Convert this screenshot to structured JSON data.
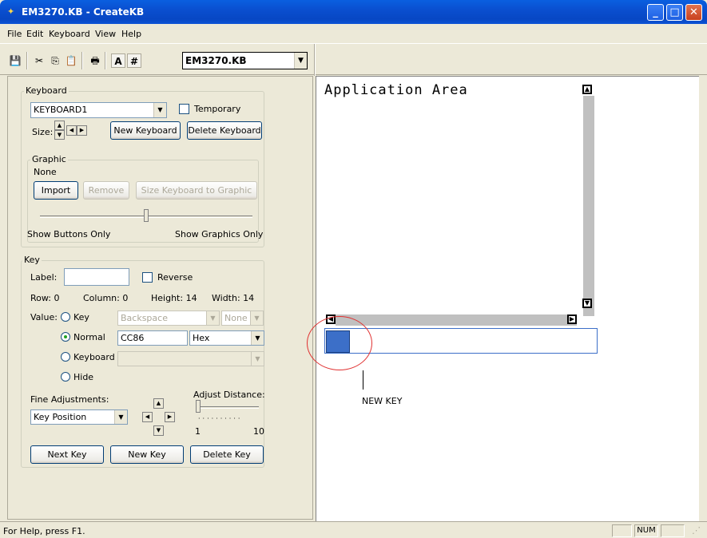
{
  "window": {
    "title": "EM3270.KB - CreateKB"
  },
  "menu": [
    "File",
    "Edit",
    "Keyboard",
    "View",
    "Help"
  ],
  "toolbar": {
    "a_label": "A",
    "hash_label": "#",
    "file_combo": "EM3270.KB"
  },
  "keyboard_group": {
    "legend": "Keyboard",
    "selected_keyboard": "KEYBOARD1",
    "temporary_label": "Temporary",
    "size_label": "Size:",
    "new_keyboard": "New Keyboard",
    "delete_keyboard": "Delete Keyboard"
  },
  "graphic_group": {
    "legend": "Graphic",
    "value": "None",
    "import": "Import",
    "remove": "Remove",
    "size_to_graphic": "Size Keyboard to Graphic",
    "show_buttons_only": "Show Buttons Only",
    "show_graphics_only": "Show Graphics Only",
    "slider_level": 0.5
  },
  "key_group": {
    "legend": "Key",
    "label_label": "Label:",
    "label_value": "",
    "reverse_label": "Reverse",
    "row": "Row: 0",
    "column": "Column: 0",
    "height": "Height: 14",
    "width": "Width: 14",
    "value_label": "Value:",
    "opt_key": "Key",
    "backspace": "Backspace",
    "none": "None",
    "opt_normal": "Normal",
    "normal_value": "CC86",
    "format": "Hex",
    "opt_keyboard": "Keyboard",
    "keyboard_value": "",
    "opt_hide": "Hide",
    "fine_adjustments": "Fine Adjustments:",
    "adjust_mode": "Key Position",
    "adjust_distance": "Adjust Distance:",
    "dist_min": "1",
    "dist_max": "10",
    "next_key": "Next Key",
    "new_key": "New Key",
    "delete_key": "Delete Key"
  },
  "app_area": {
    "title": "Application Area",
    "annotation": "NEW KEY"
  },
  "status": {
    "help": "For Help, press F1.",
    "num": "NUM"
  },
  "colors": {
    "key_fill": "#3c6fc8",
    "annotation_circle": "#e03030",
    "scroll_gray": "#c0c0c0"
  }
}
